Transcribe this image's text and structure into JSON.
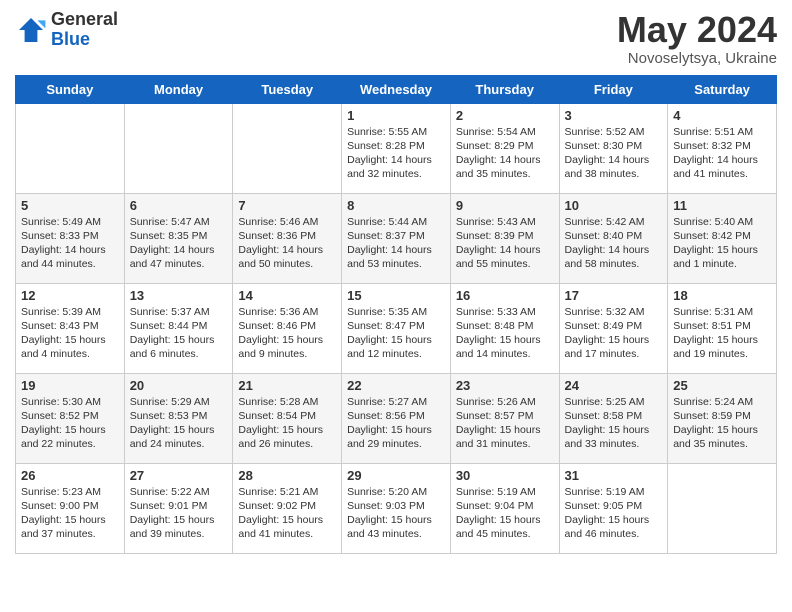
{
  "header": {
    "logo_general": "General",
    "logo_blue": "Blue",
    "title": "May 2024",
    "location": "Novoselytsya, Ukraine"
  },
  "days_of_week": [
    "Sunday",
    "Monday",
    "Tuesday",
    "Wednesday",
    "Thursday",
    "Friday",
    "Saturday"
  ],
  "weeks": [
    [
      {
        "day": "",
        "info": ""
      },
      {
        "day": "",
        "info": ""
      },
      {
        "day": "",
        "info": ""
      },
      {
        "day": "1",
        "info": "Sunrise: 5:55 AM\nSunset: 8:28 PM\nDaylight: 14 hours\nand 32 minutes."
      },
      {
        "day": "2",
        "info": "Sunrise: 5:54 AM\nSunset: 8:29 PM\nDaylight: 14 hours\nand 35 minutes."
      },
      {
        "day": "3",
        "info": "Sunrise: 5:52 AM\nSunset: 8:30 PM\nDaylight: 14 hours\nand 38 minutes."
      },
      {
        "day": "4",
        "info": "Sunrise: 5:51 AM\nSunset: 8:32 PM\nDaylight: 14 hours\nand 41 minutes."
      }
    ],
    [
      {
        "day": "5",
        "info": "Sunrise: 5:49 AM\nSunset: 8:33 PM\nDaylight: 14 hours\nand 44 minutes."
      },
      {
        "day": "6",
        "info": "Sunrise: 5:47 AM\nSunset: 8:35 PM\nDaylight: 14 hours\nand 47 minutes."
      },
      {
        "day": "7",
        "info": "Sunrise: 5:46 AM\nSunset: 8:36 PM\nDaylight: 14 hours\nand 50 minutes."
      },
      {
        "day": "8",
        "info": "Sunrise: 5:44 AM\nSunset: 8:37 PM\nDaylight: 14 hours\nand 53 minutes."
      },
      {
        "day": "9",
        "info": "Sunrise: 5:43 AM\nSunset: 8:39 PM\nDaylight: 14 hours\nand 55 minutes."
      },
      {
        "day": "10",
        "info": "Sunrise: 5:42 AM\nSunset: 8:40 PM\nDaylight: 14 hours\nand 58 minutes."
      },
      {
        "day": "11",
        "info": "Sunrise: 5:40 AM\nSunset: 8:42 PM\nDaylight: 15 hours\nand 1 minute."
      }
    ],
    [
      {
        "day": "12",
        "info": "Sunrise: 5:39 AM\nSunset: 8:43 PM\nDaylight: 15 hours\nand 4 minutes."
      },
      {
        "day": "13",
        "info": "Sunrise: 5:37 AM\nSunset: 8:44 PM\nDaylight: 15 hours\nand 6 minutes."
      },
      {
        "day": "14",
        "info": "Sunrise: 5:36 AM\nSunset: 8:46 PM\nDaylight: 15 hours\nand 9 minutes."
      },
      {
        "day": "15",
        "info": "Sunrise: 5:35 AM\nSunset: 8:47 PM\nDaylight: 15 hours\nand 12 minutes."
      },
      {
        "day": "16",
        "info": "Sunrise: 5:33 AM\nSunset: 8:48 PM\nDaylight: 15 hours\nand 14 minutes."
      },
      {
        "day": "17",
        "info": "Sunrise: 5:32 AM\nSunset: 8:49 PM\nDaylight: 15 hours\nand 17 minutes."
      },
      {
        "day": "18",
        "info": "Sunrise: 5:31 AM\nSunset: 8:51 PM\nDaylight: 15 hours\nand 19 minutes."
      }
    ],
    [
      {
        "day": "19",
        "info": "Sunrise: 5:30 AM\nSunset: 8:52 PM\nDaylight: 15 hours\nand 22 minutes."
      },
      {
        "day": "20",
        "info": "Sunrise: 5:29 AM\nSunset: 8:53 PM\nDaylight: 15 hours\nand 24 minutes."
      },
      {
        "day": "21",
        "info": "Sunrise: 5:28 AM\nSunset: 8:54 PM\nDaylight: 15 hours\nand 26 minutes."
      },
      {
        "day": "22",
        "info": "Sunrise: 5:27 AM\nSunset: 8:56 PM\nDaylight: 15 hours\nand 29 minutes."
      },
      {
        "day": "23",
        "info": "Sunrise: 5:26 AM\nSunset: 8:57 PM\nDaylight: 15 hours\nand 31 minutes."
      },
      {
        "day": "24",
        "info": "Sunrise: 5:25 AM\nSunset: 8:58 PM\nDaylight: 15 hours\nand 33 minutes."
      },
      {
        "day": "25",
        "info": "Sunrise: 5:24 AM\nSunset: 8:59 PM\nDaylight: 15 hours\nand 35 minutes."
      }
    ],
    [
      {
        "day": "26",
        "info": "Sunrise: 5:23 AM\nSunset: 9:00 PM\nDaylight: 15 hours\nand 37 minutes."
      },
      {
        "day": "27",
        "info": "Sunrise: 5:22 AM\nSunset: 9:01 PM\nDaylight: 15 hours\nand 39 minutes."
      },
      {
        "day": "28",
        "info": "Sunrise: 5:21 AM\nSunset: 9:02 PM\nDaylight: 15 hours\nand 41 minutes."
      },
      {
        "day": "29",
        "info": "Sunrise: 5:20 AM\nSunset: 9:03 PM\nDaylight: 15 hours\nand 43 minutes."
      },
      {
        "day": "30",
        "info": "Sunrise: 5:19 AM\nSunset: 9:04 PM\nDaylight: 15 hours\nand 45 minutes."
      },
      {
        "day": "31",
        "info": "Sunrise: 5:19 AM\nSunset: 9:05 PM\nDaylight: 15 hours\nand 46 minutes."
      },
      {
        "day": "",
        "info": ""
      }
    ]
  ]
}
